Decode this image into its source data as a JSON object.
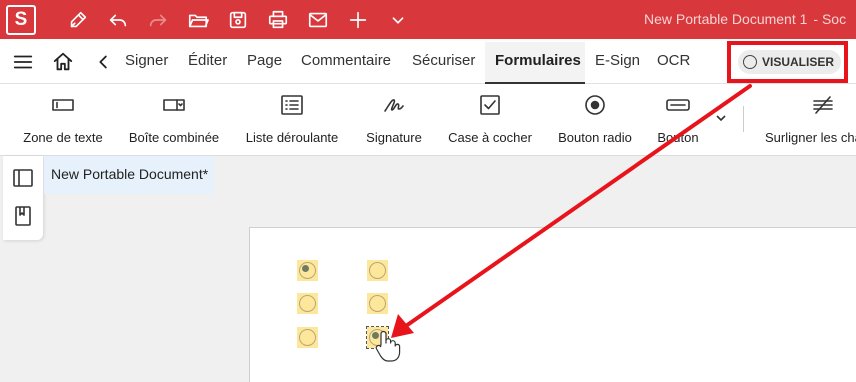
{
  "titlebar": {
    "logo": "S",
    "icons": [
      "pen-icon",
      "undo-icon",
      "redo-icon",
      "open-folder-icon",
      "save-icon",
      "print-icon",
      "mail-icon",
      "plus-icon",
      "chevron-down-icon"
    ],
    "window_title": "New Portable Document 1",
    "app_suffix": "- Soc"
  },
  "menubar": {
    "tabs": [
      {
        "label": "Signer"
      },
      {
        "label": "Éditer"
      },
      {
        "label": "Page"
      },
      {
        "label": "Commentaire"
      },
      {
        "label": "Sécuriser"
      },
      {
        "label": "Formulaires",
        "active": true
      },
      {
        "label": "E-Sign"
      },
      {
        "label": "OCR"
      }
    ],
    "preview_label": "VISUALISER"
  },
  "ribbon": {
    "items": [
      {
        "label": "Zone de texte",
        "icon": "text-field-icon"
      },
      {
        "label": "Boîte combinée",
        "icon": "combo-box-icon"
      },
      {
        "label": "Liste déroulante",
        "icon": "list-box-icon"
      },
      {
        "label": "Signature",
        "icon": "signature-icon"
      },
      {
        "label": "Case à cocher",
        "icon": "checkbox-icon"
      },
      {
        "label": "Bouton radio",
        "icon": "radio-button-icon"
      },
      {
        "label": "Bouton",
        "icon": "button-icon"
      },
      {
        "label": "Surligner les cha",
        "icon": "highlight-fields-icon"
      }
    ]
  },
  "document": {
    "tab_title": "New Portable Document*"
  },
  "form_fields": {
    "radio_buttons": [
      {
        "column": 1,
        "row": 1,
        "checked": true
      },
      {
        "column": 2,
        "row": 1,
        "checked": false
      },
      {
        "column": 1,
        "row": 2,
        "checked": false
      },
      {
        "column": 2,
        "row": 2,
        "checked": false
      },
      {
        "column": 1,
        "row": 3,
        "checked": false
      },
      {
        "column": 2,
        "row": 3,
        "checked": true,
        "selected": true
      }
    ]
  },
  "colors": {
    "titlebar": "#d8383c",
    "annotation": "#e8141b",
    "field_fill": "#fde79a",
    "doc_tab": "#e7f1fb"
  }
}
